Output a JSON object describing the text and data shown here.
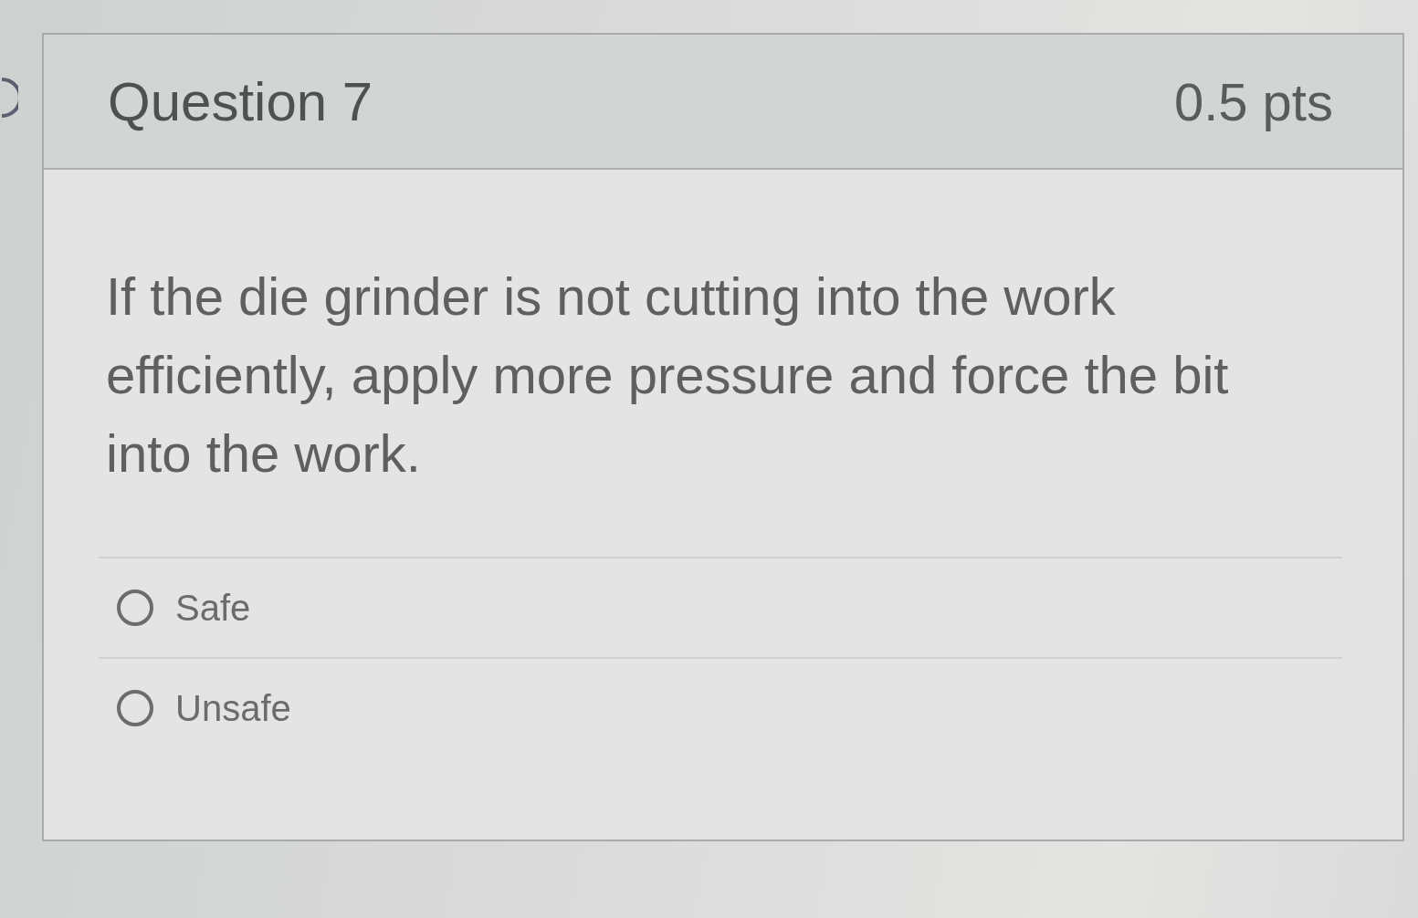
{
  "question": {
    "title": "Question 7",
    "points": "0.5 pts",
    "text": "If the die grinder is not cutting into the work efficiently, apply more pressure and force the bit into the work.",
    "answers": [
      {
        "label": "Safe",
        "selected": false
      },
      {
        "label": "Unsafe",
        "selected": false
      }
    ]
  }
}
